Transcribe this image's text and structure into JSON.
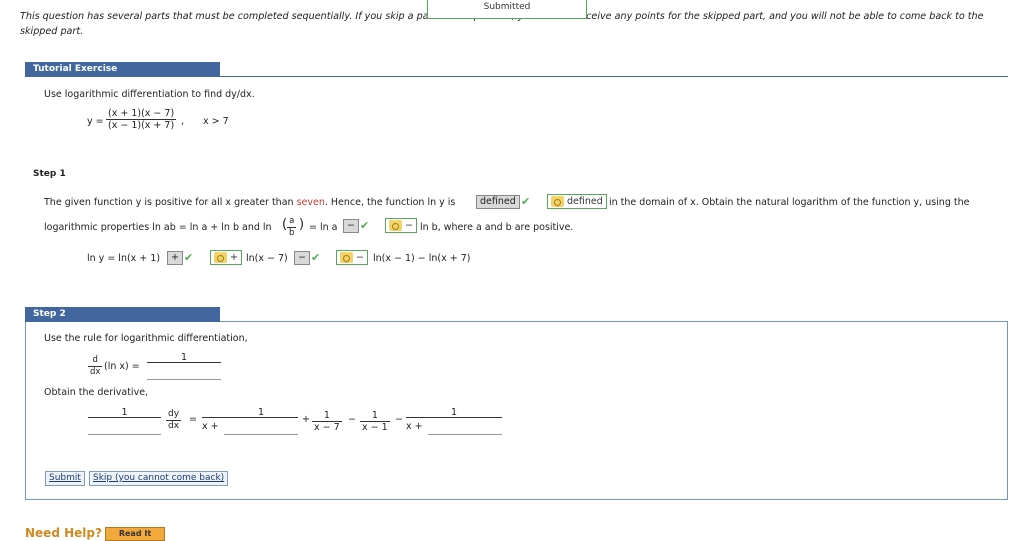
{
  "notice": {
    "text": "This question has several parts that must be completed sequentially. If you skip a part of the question, you will not receive any points for the skipped part, and you will not be able to come back to the skipped part."
  },
  "banner": {
    "label": "Submitted"
  },
  "tutorial": {
    "header": "Tutorial Exercise",
    "prompt": "Use logarithmic differentiation to find dy/dx.",
    "y_eq": "y =",
    "frac_num": "(x + 1)(x − 7)",
    "frac_den": "(x − 1)(x + 7)",
    "comma": ",",
    "condition": "x > 7"
  },
  "step1": {
    "label": "Step 1",
    "line1_pre": "The given function y is positive for all x greater than ",
    "line1_red": "seven",
    "line1_mid": ". Hence, the function ln y is",
    "answer1_value": "defined",
    "answer1_key": "defined",
    "line1_post": "in the domain of x. Obtain the natural logarithm of the function y, using the",
    "line2_pre": "logarithmic properties ln ab = ln a + ln b and ln",
    "line2_frac_num": "a",
    "line2_frac_den": "b",
    "line2_eq": "= ln a",
    "answer2_value": "−",
    "answer2_key": "−",
    "line2_post": "ln b, where a and b are positive.",
    "lny_eq": "ln y = ln(x + 1)",
    "ans3_value": "+",
    "ans3_key": "+",
    "lny_mid": "ln(x − 7)",
    "ans4_value": "−",
    "ans4_key": "−",
    "lny_post": "ln(x − 1) − ln(x + 7)"
  },
  "step2": {
    "label": "Step 2",
    "prompt": "Use the rule for logarithmic differentiation,",
    "d_num": "d",
    "d_den": "dx",
    "ln_x": "(ln x) =",
    "rule_num": "1",
    "obtain": "Obtain the derivative,",
    "deriv_num1": "1",
    "dy_num": "dy",
    "dy_den": "dx",
    "eq": "=",
    "t1_num": "1",
    "t1_den": "x +",
    "plus": "+",
    "t2_num": "1",
    "t2_den": "x − 7",
    "minus1": "−",
    "t3_num": "1",
    "t3_den": "x − 1",
    "minus2": "−",
    "t4_num": "1",
    "t4_den": "x +",
    "submit": "Submit",
    "skip": "Skip (you cannot come back)"
  },
  "help": {
    "label": "Need Help?",
    "read_it": "Read It"
  },
  "colors": {
    "accent": "#41679e",
    "correct": "#4caf50",
    "highlight": "#c0392b"
  },
  "icons": [
    "check-icon",
    "key-icon"
  ]
}
